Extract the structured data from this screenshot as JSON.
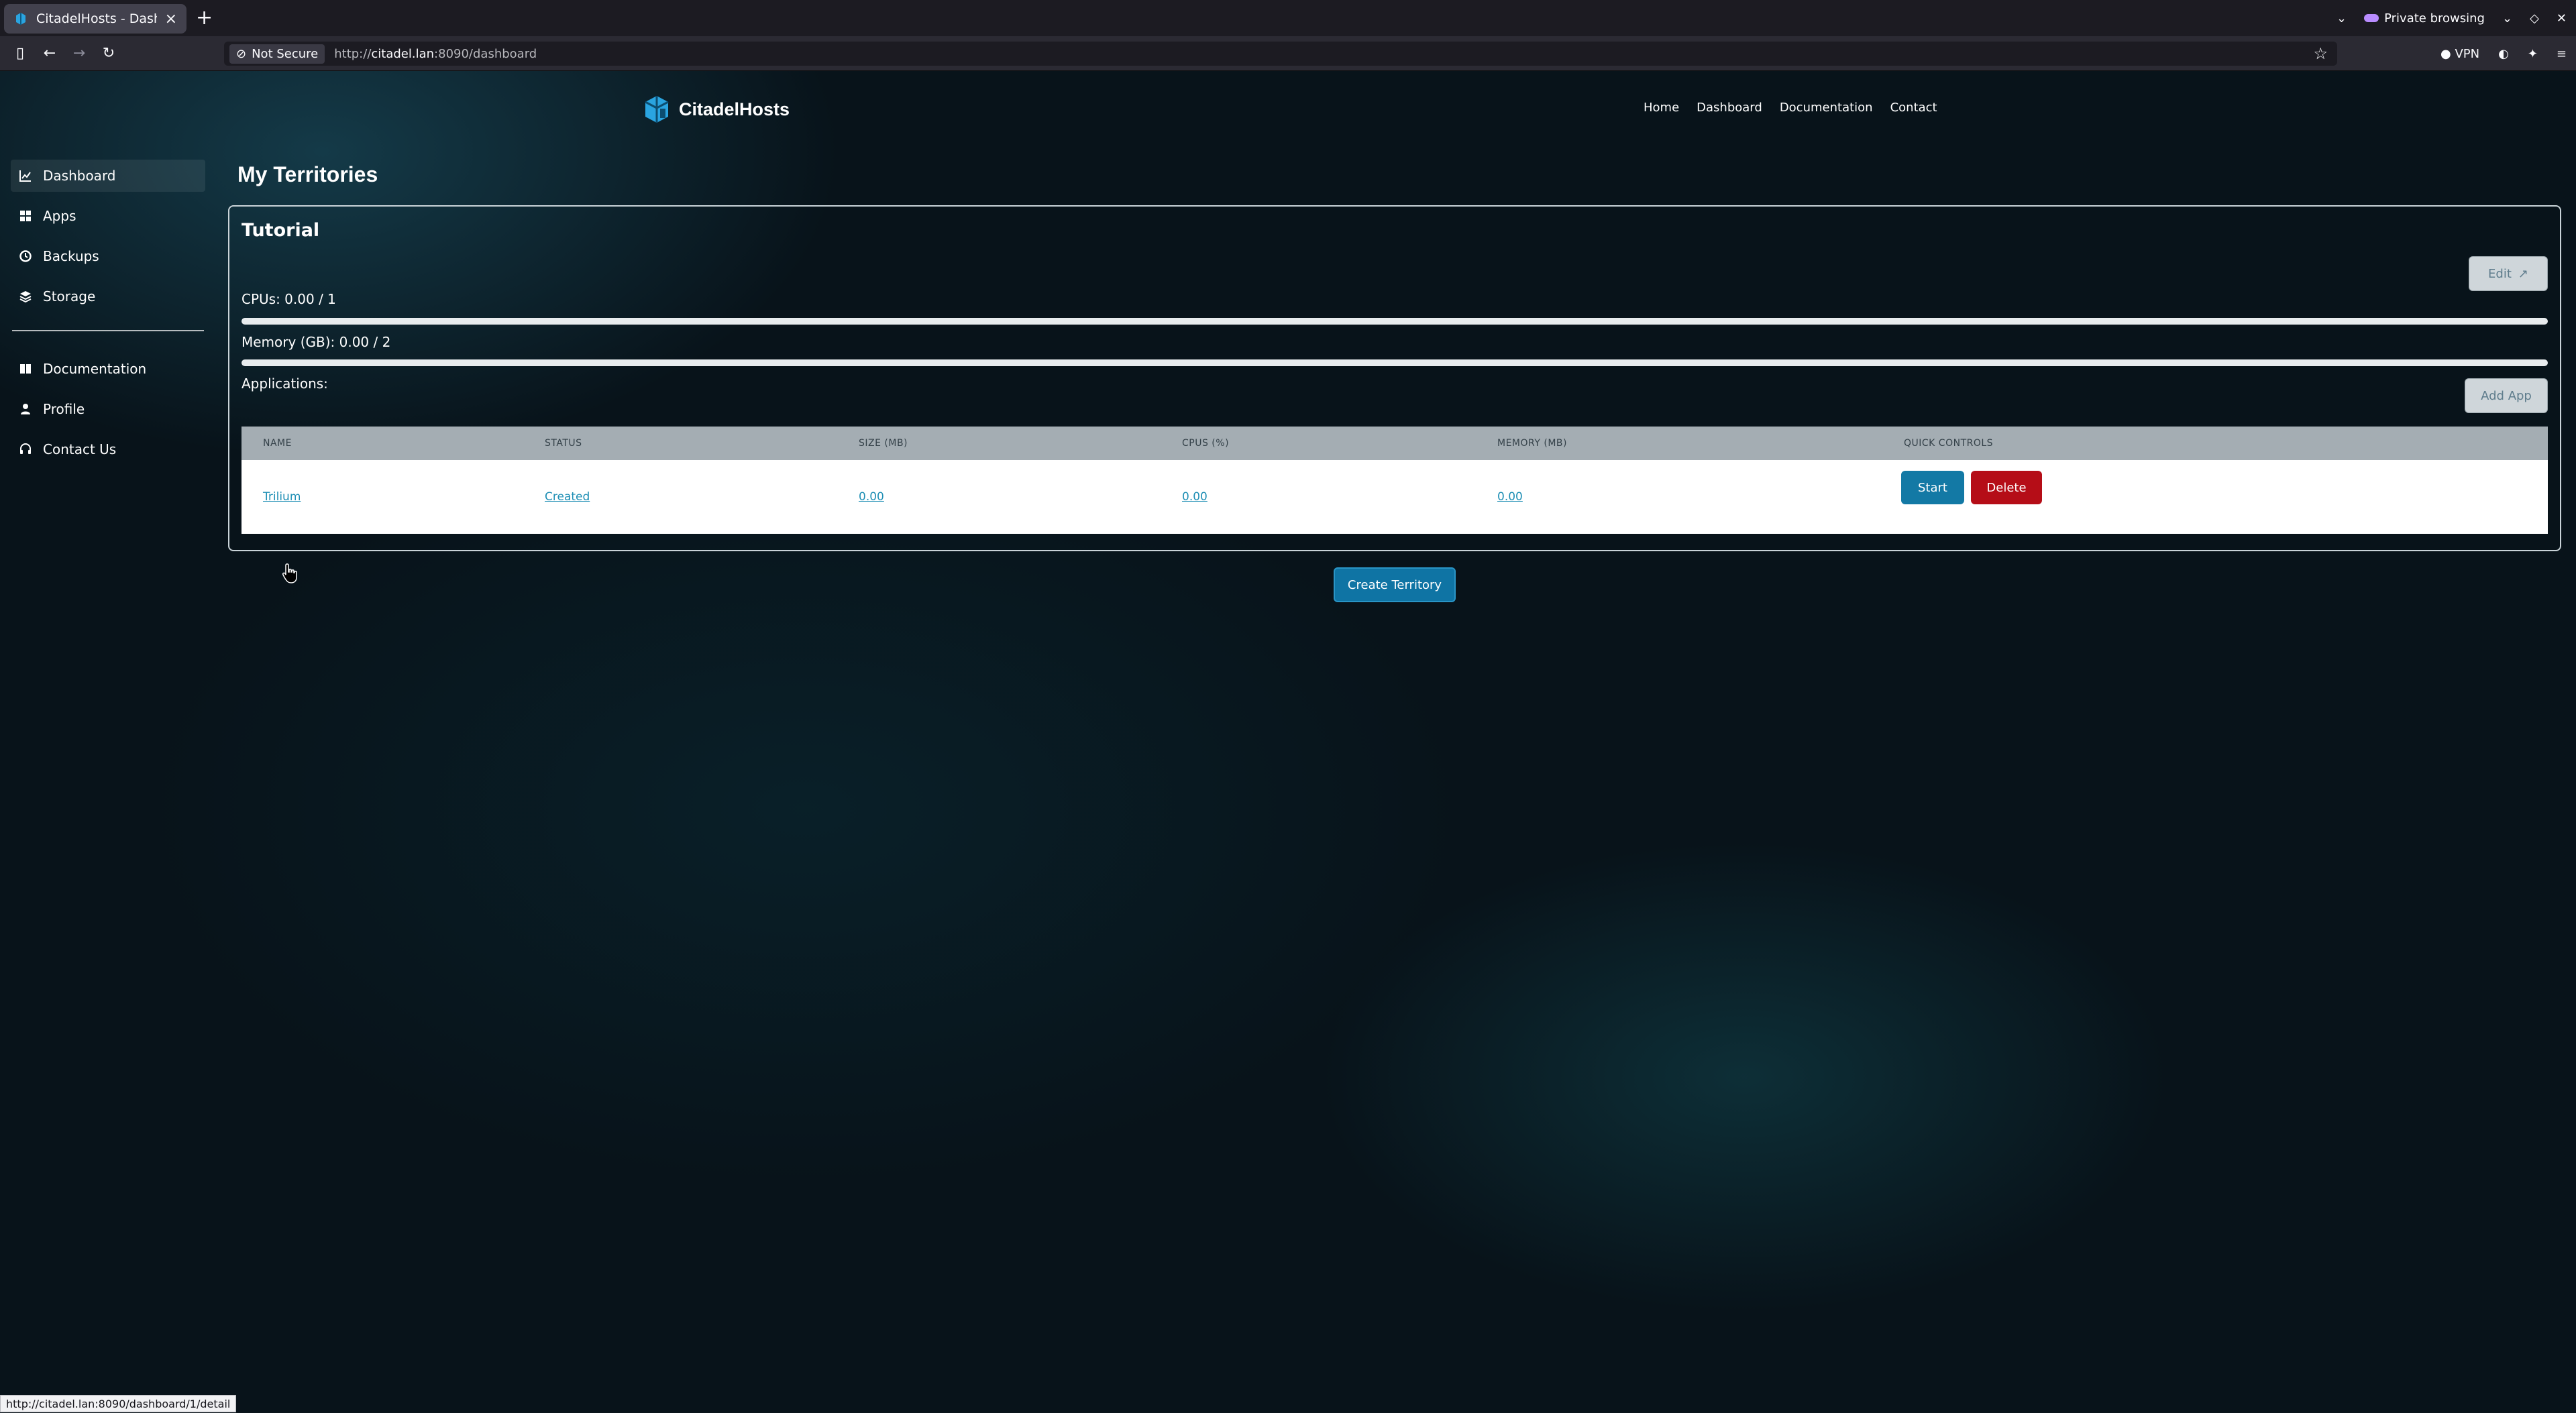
{
  "browser": {
    "tab_title": "CitadelHosts - Dashboard",
    "new_tab": "+",
    "private_label": "Private browsing",
    "not_secure": "Not Secure",
    "url_prefix": "http://",
    "url_host": "citadel.lan",
    "url_rest": ":8090/dashboard",
    "vpn_label": "VPN",
    "status_url": "http://citadel.lan:8090/dashboard/1/detail"
  },
  "site": {
    "brand": "CitadelHosts",
    "nav": [
      "Home",
      "Dashboard",
      "Documentation",
      "Contact"
    ]
  },
  "sidebar": {
    "items": [
      {
        "label": "Dashboard",
        "icon": "chart-line-icon"
      },
      {
        "label": "Apps",
        "icon": "grid-icon"
      },
      {
        "label": "Backups",
        "icon": "backup-icon"
      },
      {
        "label": "Storage",
        "icon": "layers-icon"
      }
    ],
    "secondary": [
      {
        "label": "Documentation",
        "icon": "book-icon"
      },
      {
        "label": "Profile",
        "icon": "user-icon"
      },
      {
        "label": "Contact Us",
        "icon": "headset-icon"
      }
    ]
  },
  "main": {
    "title": "My Territories",
    "territory": {
      "name": "Tutorial",
      "edit_label": "Edit",
      "cpus_label": "CPUs: 0.00 / 1",
      "cpus_used": 0.0,
      "cpus_total": 1,
      "memory_label": "Memory (GB): 0.00 / 2",
      "memory_used": 0.0,
      "memory_total": 2,
      "applications_label": "Applications:",
      "add_app_label": "Add App",
      "table": {
        "headers": [
          "NAME",
          "STATUS",
          "SIZE (MB)",
          "CPUS (%)",
          "MEMORY (MB)",
          "QUICK CONTROLS"
        ],
        "rows": [
          {
            "name": "Trilium",
            "status": "Created",
            "size": "0.00",
            "cpus": "0.00",
            "memory": "0.00",
            "start": "Start",
            "delete": "Delete"
          }
        ]
      }
    },
    "create_label": "Create Territory"
  },
  "colors": {
    "accent": "#1379a5",
    "danger": "#b50d17",
    "link": "#1f8fb5"
  }
}
